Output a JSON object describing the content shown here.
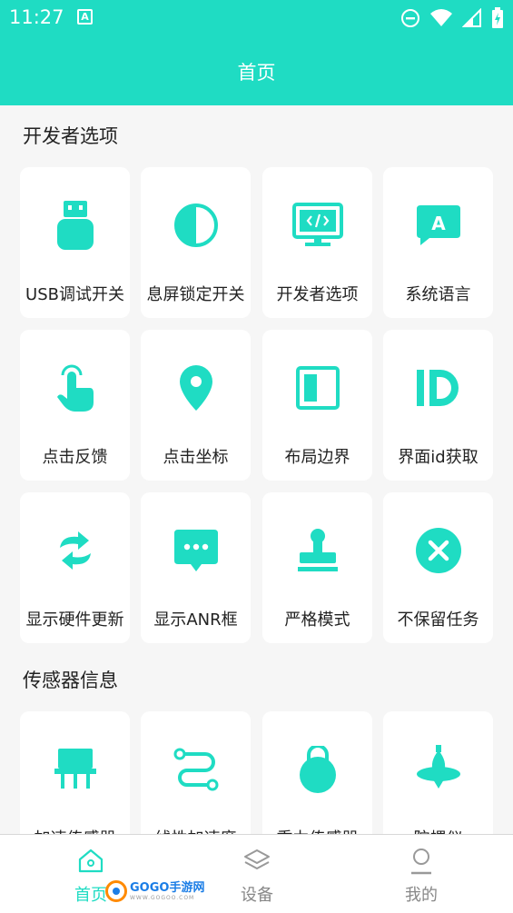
{
  "status_bar": {
    "time": "11:27",
    "notif_icon": "A"
  },
  "app_bar": {
    "title": "首页"
  },
  "sections": {
    "developer": {
      "title": "开发者选项"
    },
    "sensor": {
      "title": "传感器信息"
    }
  },
  "dev_items": [
    {
      "label": "USB调试开关",
      "icon": "usb-icon"
    },
    {
      "label": "息屏锁定开关",
      "icon": "half-circle-icon"
    },
    {
      "label": "开发者选项",
      "icon": "code-monitor-icon"
    },
    {
      "label": "系统语言",
      "icon": "language-icon"
    },
    {
      "label": "点击反馈",
      "icon": "tap-hand-icon"
    },
    {
      "label": "点击坐标",
      "icon": "location-pin-icon"
    },
    {
      "label": "布局边界",
      "icon": "layout-border-icon"
    },
    {
      "label": "界面id获取",
      "icon": "id-icon"
    },
    {
      "label": "显示硬件更新",
      "icon": "refresh-arrows-icon"
    },
    {
      "label": "显示ANR框",
      "icon": "chat-dots-icon"
    },
    {
      "label": "严格模式",
      "icon": "stamp-icon"
    },
    {
      "label": "不保留任务",
      "icon": "close-circle-icon"
    }
  ],
  "sensor_items": [
    {
      "label": "加速传感器",
      "icon": "chip-icon"
    },
    {
      "label": "线性加速度",
      "icon": "path-icon"
    },
    {
      "label": "重力传感器",
      "icon": "kettlebell-icon"
    },
    {
      "label": "陀螺仪",
      "icon": "gyroscope-icon"
    }
  ],
  "bottom_nav": [
    {
      "label": "首页",
      "icon": "home-icon",
      "active": true
    },
    {
      "label": "设备",
      "icon": "layers-icon",
      "active": false
    },
    {
      "label": "我的",
      "icon": "user-icon",
      "active": false
    }
  ],
  "watermark": {
    "text": "GOGO手游网",
    "sub": "WWW.GOGOO.COM"
  },
  "colors": {
    "accent": "#1fdcc3",
    "background": "#f6f6f6",
    "card": "#ffffff"
  }
}
